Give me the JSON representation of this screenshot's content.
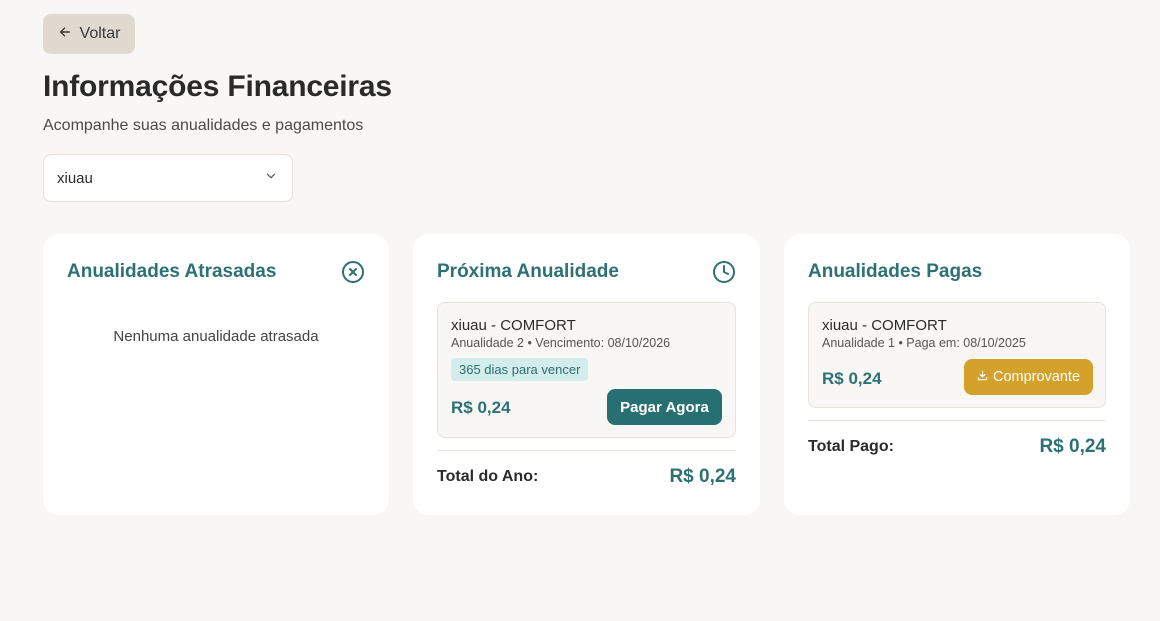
{
  "header": {
    "back_label": "Voltar",
    "title": "Informações Financeiras",
    "subtitle": "Acompanhe suas anualidades e pagamentos"
  },
  "selector": {
    "value": "xiuau"
  },
  "overdue": {
    "title": "Anualidades Atrasadas",
    "empty": "Nenhuma anualidade atrasada"
  },
  "next": {
    "title": "Próxima Anualidade",
    "item": {
      "name": "xiuau - COMFORT",
      "meta": "Anualidade 2 • Vencimento: 08/10/2026",
      "badge": "365 dias para vencer",
      "amount": "R$ 0,24",
      "pay_label": "Pagar Agora"
    },
    "total_label": "Total do Ano:",
    "total_value": "R$ 0,24"
  },
  "paid": {
    "title": "Anualidades Pagas",
    "item": {
      "name": "xiuau - COMFORT",
      "meta": "Anualidade 1 • Paga em: 08/10/2025",
      "amount": "R$ 0,24",
      "receipt_label": "Comprovante"
    },
    "total_label": "Total Pago:",
    "total_value": "R$ 0,24"
  },
  "icons": {
    "back": "arrow-left-icon",
    "select": "chevron-down-icon",
    "overdue": "x-circle-icon",
    "next": "clock-icon",
    "receipt": "download-icon"
  },
  "colors": {
    "accent": "#2e7174",
    "primary_button": "#276f70",
    "receipt_button": "#d4a12b",
    "back_button": "#e0d9cf",
    "badge_bg": "#d3ecec",
    "background": "#f9f7f5"
  }
}
